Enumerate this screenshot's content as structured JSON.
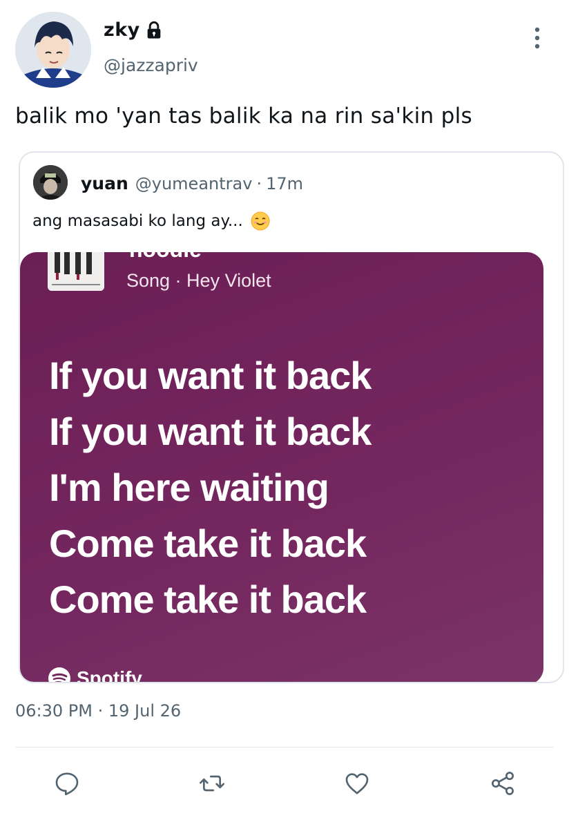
{
  "author": {
    "display_name": "zky",
    "handle": "@jazzapriv"
  },
  "icons": {
    "lock": "lock-icon",
    "more": "more-vertical-icon",
    "emoji": "smiling-face-emoji",
    "reply": "reply-icon",
    "retweet": "retweet-icon",
    "like": "heart-icon",
    "share": "share-icon",
    "spotify": "spotify-logo-icon"
  },
  "tweet": {
    "text": "balik mo 'yan tas balik ka na rin sa'kin pls",
    "timestamp": "06:30 PM · 19 Jul 26"
  },
  "quote": {
    "display_name": "yuan",
    "handle": "@yumeantrav",
    "separator": "·",
    "time": "17m",
    "text": "ang masasabi ko lang ay..."
  },
  "media": {
    "song_title_partial": "hoodie",
    "song_meta": "Song · Hey Violet",
    "lyrics": [
      "If you want it back",
      "If you want it back",
      "I'm here waiting",
      "Come take it back",
      "Come take it back"
    ],
    "brand": "Spotify"
  },
  "colors": {
    "secondary_text": "#536471",
    "border": "#dfe5ea",
    "card_background": "#6c1f55"
  }
}
